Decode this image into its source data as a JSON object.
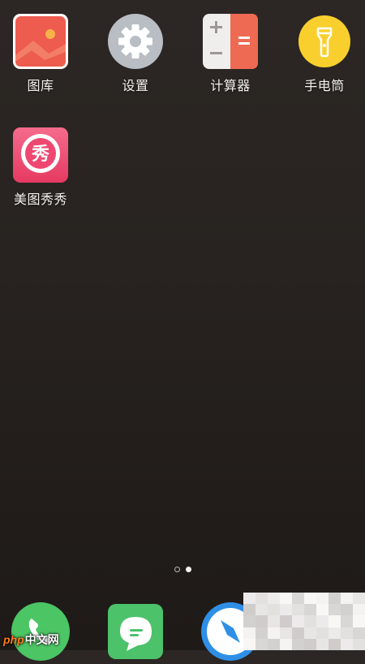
{
  "apps": [
    {
      "id": "gallery",
      "label": "图库",
      "icon": "gallery-icon"
    },
    {
      "id": "settings",
      "label": "设置",
      "icon": "gear-icon"
    },
    {
      "id": "calculator",
      "label": "计算器",
      "icon": "calculator-icon"
    },
    {
      "id": "flashlight",
      "label": "手电筒",
      "icon": "flashlight-icon"
    },
    {
      "id": "meitu",
      "label": "美图秀秀",
      "icon": "meitu-icon",
      "icon_text": "秀"
    }
  ],
  "page_indicator": {
    "total_pages": 2,
    "current_page": 2
  },
  "dock": [
    {
      "id": "phone",
      "icon": "phone-icon"
    },
    {
      "id": "messages",
      "icon": "message-icon"
    },
    {
      "id": "browser",
      "icon": "compass-icon"
    }
  ],
  "watermark": {
    "prefix": "php",
    "text": "中文网"
  },
  "colors": {
    "gallery": "#ee5b4f",
    "settings": "#b9bdc4",
    "calculator_left": "#f0eeec",
    "calculator_right": "#ee6a52",
    "flashlight": "#f8cf2c",
    "meitu": "#ee4870",
    "phone": "#4cc565",
    "messages": "#4cc26b",
    "browser": "#2f8fe6"
  }
}
